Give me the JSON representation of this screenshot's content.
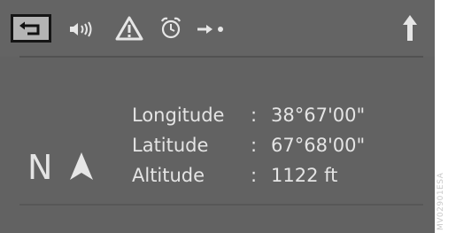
{
  "toolbar": {
    "icons": [
      "back-icon",
      "speaker-icon",
      "warning-icon",
      "alarm-clock-icon",
      "arrow-dot-icon",
      "up-arrow-icon"
    ]
  },
  "compass": {
    "direction": "N"
  },
  "position_info": {
    "rows": [
      {
        "label": "Longitude",
        "separator": ":",
        "value": "38°67'00\""
      },
      {
        "label": "Latitude",
        "separator": ":",
        "value": "67°68'00\""
      },
      {
        "label": "Altitude",
        "separator": ":",
        "value": "1122 ft"
      }
    ]
  },
  "watermark": "MV02901ESA",
  "colors": {
    "screen_bg": "#626262",
    "text": "#e4e4e4",
    "back_button_bg": "#b4b4b4"
  }
}
